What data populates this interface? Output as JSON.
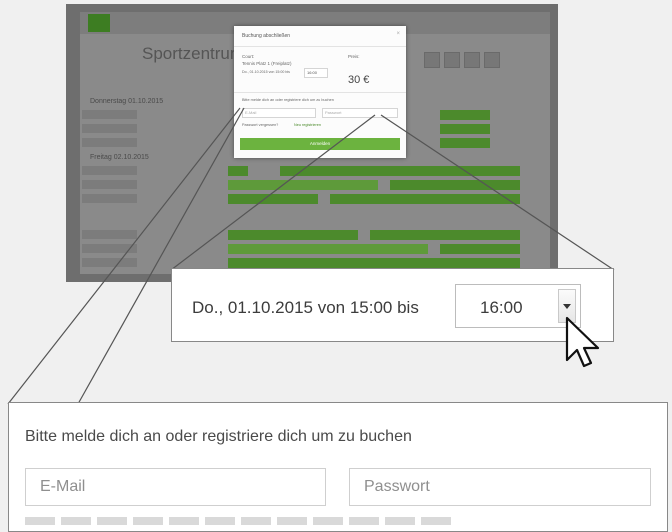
{
  "background_app": {
    "title": "Sportzentrum M",
    "section_1": "Donnerstag 01.10.2015",
    "section_2": "Freitag 02.10.2015"
  },
  "booking_modal": {
    "header": "Buchung abschließen",
    "close_glyph": "×",
    "court_label": "Court:",
    "court_value": "Tennis Platz 1 (Freiplatz)",
    "date_text": "Do., 01.10.2015 von 15:00 bis",
    "end_time_value": "16:00",
    "price_label": "Preis:",
    "price_value": "30 €",
    "login_prompt": "Bitte melde dich an oder registriere dich um zu buchen",
    "email_placeholder": "E-Mail",
    "password_placeholder": "Passwort",
    "forgot_text": "Passwort vergessen?",
    "register_link": "Neu registrieren",
    "submit_label": "Anmelden"
  },
  "zoom_time": {
    "label": "Do., 01.10.2015 von 15:00 bis",
    "end_time_value": "16:00"
  },
  "zoom_login": {
    "prompt": "Bitte melde dich an oder registriere dich um zu buchen",
    "email_placeholder": "E-Mail",
    "password_placeholder": "Passwort"
  },
  "colors": {
    "accent_green": "#6cb33f",
    "dimmed_green": "#4c8a2c",
    "text": "#3c3c3c"
  },
  "icons": [
    "dropdown-caret-icon",
    "pointer-cursor-icon",
    "close-icon",
    "logo-icon"
  ]
}
